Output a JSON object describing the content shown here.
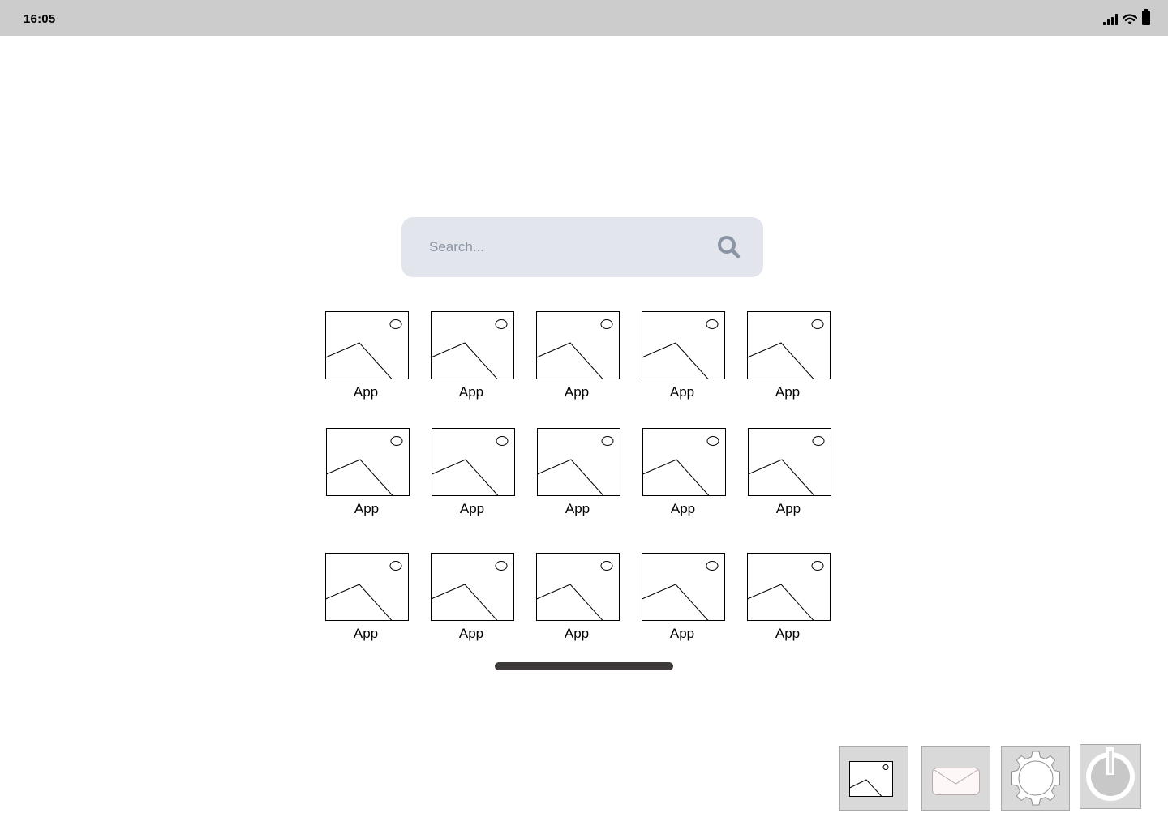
{
  "status_bar": {
    "time": "16:05",
    "icons": [
      "cellular-signal-icon",
      "wifi-icon",
      "battery-icon"
    ]
  },
  "search": {
    "placeholder": "Search...",
    "value": "",
    "icon": "search-icon"
  },
  "apps": [
    {
      "label": "App",
      "icon": "image-placeholder-icon"
    },
    {
      "label": "App",
      "icon": "image-placeholder-icon"
    },
    {
      "label": "App",
      "icon": "image-placeholder-icon"
    },
    {
      "label": "App",
      "icon": "image-placeholder-icon"
    },
    {
      "label": "App",
      "icon": "image-placeholder-icon"
    },
    {
      "label": "App",
      "icon": "image-placeholder-icon"
    },
    {
      "label": "App",
      "icon": "image-placeholder-icon"
    },
    {
      "label": "App",
      "icon": "image-placeholder-icon"
    },
    {
      "label": "App",
      "icon": "image-placeholder-icon"
    },
    {
      "label": "App",
      "icon": "image-placeholder-icon"
    },
    {
      "label": "App",
      "icon": "image-placeholder-icon"
    },
    {
      "label": "App",
      "icon": "image-placeholder-icon"
    },
    {
      "label": "App",
      "icon": "image-placeholder-icon"
    },
    {
      "label": "App",
      "icon": "image-placeholder-icon"
    },
    {
      "label": "App",
      "icon": "image-placeholder-icon"
    }
  ],
  "dock": {
    "buttons": [
      {
        "name": "gallery-button",
        "icon": "image-icon"
      },
      {
        "name": "mail-button",
        "icon": "mail-icon"
      },
      {
        "name": "settings-button",
        "icon": "gear-icon"
      },
      {
        "name": "power-button",
        "icon": "power-icon"
      }
    ]
  },
  "colors": {
    "status_bar_bg": "#cccccc",
    "search_bg": "#e2e5eb",
    "search_placeholder": "#8a94a3",
    "page_indicator": "#3f3a3a",
    "dock_button_bg": "#d9d9d9"
  }
}
